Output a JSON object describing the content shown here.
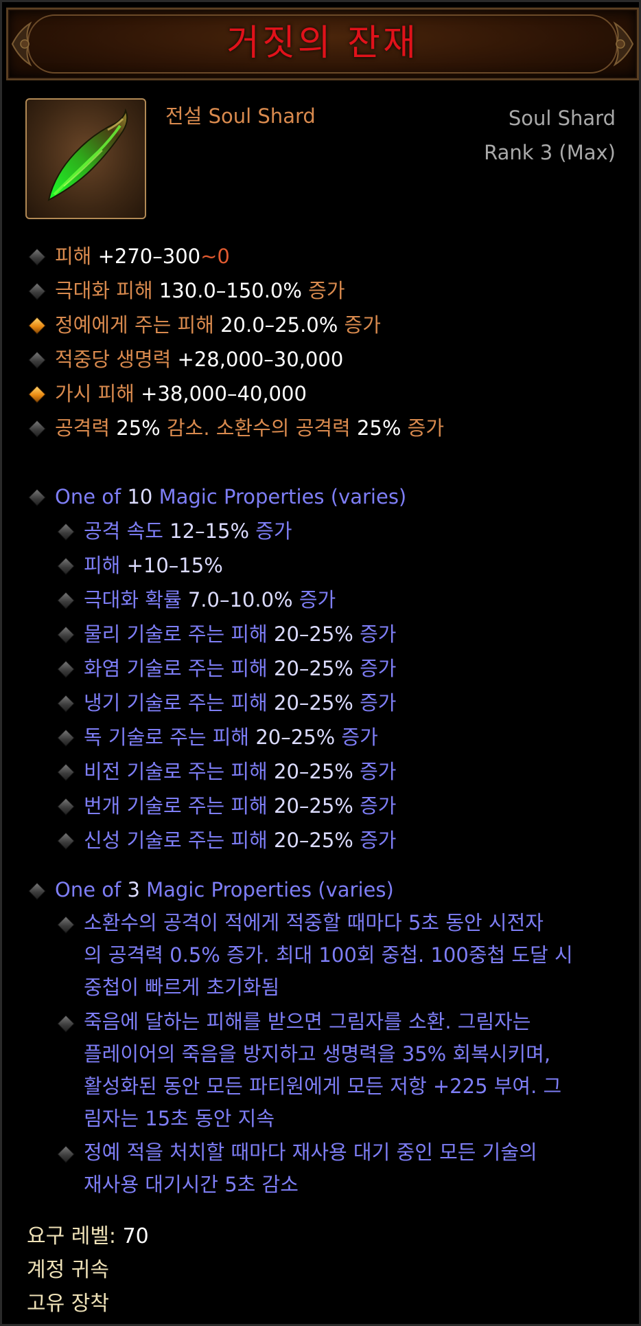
{
  "item": {
    "name": "거짓의 잔재",
    "rarity_prefix": "전설",
    "rarity_type": "Soul Shard",
    "category": "Soul Shard",
    "rank": "Rank 3 (Max)",
    "icon": "soul-shard-green-icon"
  },
  "primary": [
    {
      "bullet": "grey",
      "label": "피해",
      "value": "+270–300",
      "tail": "~0",
      "suffix": ""
    },
    {
      "bullet": "grey",
      "label": "극대화 피해",
      "value": "130.0–150.0%",
      "suffix": "증가"
    },
    {
      "bullet": "orange",
      "label": "정예에게 주는 피해",
      "value": "20.0–25.0%",
      "suffix": "증가"
    },
    {
      "bullet": "grey",
      "label": "적중당 생명력",
      "value": "+28,000–30,000",
      "suffix": ""
    },
    {
      "bullet": "orange",
      "label": "가시 피해",
      "value": "+38,000–40,000",
      "suffix": ""
    },
    {
      "bullet": "grey",
      "label": "공격력",
      "value": "25%",
      "mid": "감소. 소환수의 공격력",
      "value2": "25%",
      "suffix": "증가"
    }
  ],
  "group1": {
    "pre": "One of",
    "count": "10",
    "post": "Magic Properties (varies)",
    "items": [
      {
        "label": "공격 속도",
        "value": "12–15%",
        "suffix": "증가"
      },
      {
        "label": "피해",
        "value": "+10–15%",
        "suffix": ""
      },
      {
        "label": "극대화 확률",
        "value": "7.0–10.0%",
        "suffix": "증가"
      },
      {
        "label": "물리 기술로 주는 피해",
        "value": "20–25%",
        "suffix": "증가"
      },
      {
        "label": "화염 기술로 주는 피해",
        "value": "20–25%",
        "suffix": "증가"
      },
      {
        "label": "냉기 기술로 주는 피해",
        "value": "20–25%",
        "suffix": "증가"
      },
      {
        "label": "독 기술로 주는 피해",
        "value": "20–25%",
        "suffix": "증가"
      },
      {
        "label": "비전 기술로 주는 피해",
        "value": "20–25%",
        "suffix": "증가"
      },
      {
        "label": "번개 기술로 주는 피해",
        "value": "20–25%",
        "suffix": "증가"
      },
      {
        "label": "신성 기술로 주는 피해",
        "value": "20–25%",
        "suffix": "증가"
      }
    ]
  },
  "group2": {
    "pre": "One of",
    "count": "3",
    "post": "Magic Properties (varies)",
    "items": [
      {
        "lines": [
          "소환수의 공격이 적에게 적중할 때마다 5초 동안 시전자",
          "의 공격력 0.5% 증가. 최대 100회 중첩. 100중첩 도달 시",
          "중첩이 빠르게 초기화됨"
        ]
      },
      {
        "lines": [
          "죽음에 달하는 피해를 받으면 그림자를 소환. 그림자는",
          "플레이어의 죽음을 방지하고 생명력을 35% 회복시키며,",
          "활성화된 동안 모든 파티원에게 모든 저항 +225 부여. 그",
          "림자는 15초 동안 지속"
        ]
      },
      {
        "lines": [
          "정예 적을 처치할 때마다 재사용 대기 중인 모든 기술의",
          "재사용 대기시간 5초 감소"
        ]
      }
    ]
  },
  "footer": {
    "level_label": "요구 레벨:",
    "level_value": "70",
    "bound": "계정 귀속",
    "unique": "고유 장착"
  }
}
